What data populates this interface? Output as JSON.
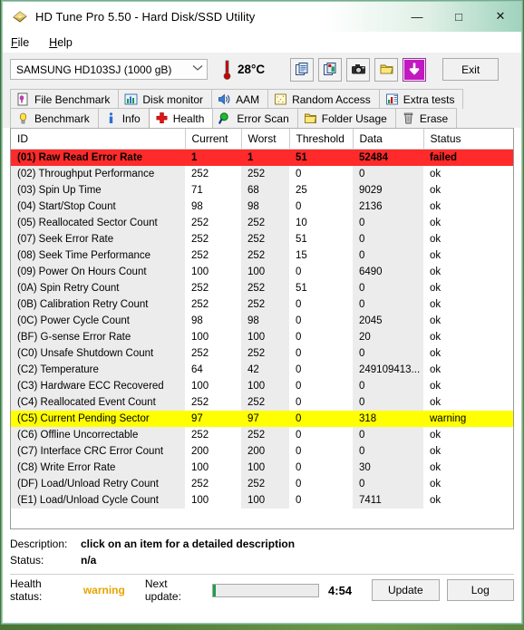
{
  "window": {
    "title": "HD Tune Pro 5.50 - Hard Disk/SSD Utility",
    "app_icon": "hard-disk-icon",
    "minimize": "—",
    "maximize": "□",
    "close": "✕"
  },
  "menu": {
    "items": [
      {
        "label": "File",
        "accel": "F"
      },
      {
        "label": "Help",
        "accel": "H"
      }
    ]
  },
  "toolbar": {
    "drive_selected": "SAMSUNG HD103SJ (1000 gB)",
    "dropdown_icon": "chevron-down-icon",
    "temperature": "28°C",
    "thermometer_icon": "thermometer-icon",
    "buttons": [
      {
        "name": "copy-icon"
      },
      {
        "name": "copy-image-icon"
      },
      {
        "name": "camera-icon"
      },
      {
        "name": "folder-gold-icon"
      },
      {
        "name": "download-arrow-icon"
      }
    ],
    "exit_label": "Exit"
  },
  "tabs": {
    "row1": [
      {
        "label": "File Benchmark",
        "icon": "file-benchmark-icon",
        "active": false
      },
      {
        "label": "Disk monitor",
        "icon": "disk-monitor-icon",
        "active": false
      },
      {
        "label": "AAM",
        "icon": "speaker-icon",
        "active": false
      },
      {
        "label": "Random Access",
        "icon": "random-access-icon",
        "active": false
      },
      {
        "label": "Extra tests",
        "icon": "extra-tests-icon",
        "active": false
      }
    ],
    "row2": [
      {
        "label": "Benchmark",
        "icon": "bulb-icon",
        "active": false
      },
      {
        "label": "Info",
        "icon": "info-icon",
        "active": false
      },
      {
        "label": "Health",
        "icon": "health-cross-icon",
        "active": true
      },
      {
        "label": "Error Scan",
        "icon": "magnifier-icon",
        "active": false
      },
      {
        "label": "Folder Usage",
        "icon": "folder-icon",
        "active": false
      },
      {
        "label": "Erase",
        "icon": "trash-icon",
        "active": false
      }
    ]
  },
  "table": {
    "columns": [
      "ID",
      "Current",
      "Worst",
      "Threshold",
      "Data",
      "Status"
    ],
    "rows": [
      {
        "id": "(01) Raw Read Error Rate",
        "current": "1",
        "worst": "1",
        "threshold": "51",
        "data": "52484",
        "status": "failed",
        "state": "failed"
      },
      {
        "id": "(02) Throughput Performance",
        "current": "252",
        "worst": "252",
        "threshold": "0",
        "data": "0",
        "status": "ok",
        "state": "normal"
      },
      {
        "id": "(03) Spin Up Time",
        "current": "71",
        "worst": "68",
        "threshold": "25",
        "data": "9029",
        "status": "ok",
        "state": "normal"
      },
      {
        "id": "(04) Start/Stop Count",
        "current": "98",
        "worst": "98",
        "threshold": "0",
        "data": "2136",
        "status": "ok",
        "state": "normal"
      },
      {
        "id": "(05) Reallocated Sector Count",
        "current": "252",
        "worst": "252",
        "threshold": "10",
        "data": "0",
        "status": "ok",
        "state": "normal"
      },
      {
        "id": "(07) Seek Error Rate",
        "current": "252",
        "worst": "252",
        "threshold": "51",
        "data": "0",
        "status": "ok",
        "state": "normal"
      },
      {
        "id": "(08) Seek Time Performance",
        "current": "252",
        "worst": "252",
        "threshold": "15",
        "data": "0",
        "status": "ok",
        "state": "normal"
      },
      {
        "id": "(09) Power On Hours Count",
        "current": "100",
        "worst": "100",
        "threshold": "0",
        "data": "6490",
        "status": "ok",
        "state": "normal"
      },
      {
        "id": "(0A) Spin Retry Count",
        "current": "252",
        "worst": "252",
        "threshold": "51",
        "data": "0",
        "status": "ok",
        "state": "normal"
      },
      {
        "id": "(0B) Calibration Retry Count",
        "current": "252",
        "worst": "252",
        "threshold": "0",
        "data": "0",
        "status": "ok",
        "state": "normal"
      },
      {
        "id": "(0C) Power Cycle Count",
        "current": "98",
        "worst": "98",
        "threshold": "0",
        "data": "2045",
        "status": "ok",
        "state": "normal"
      },
      {
        "id": "(BF) G-sense Error Rate",
        "current": "100",
        "worst": "100",
        "threshold": "0",
        "data": "20",
        "status": "ok",
        "state": "normal"
      },
      {
        "id": "(C0) Unsafe Shutdown Count",
        "current": "252",
        "worst": "252",
        "threshold": "0",
        "data": "0",
        "status": "ok",
        "state": "normal"
      },
      {
        "id": "(C2) Temperature",
        "current": "64",
        "worst": "42",
        "threshold": "0",
        "data": "249109413...",
        "status": "ok",
        "state": "normal"
      },
      {
        "id": "(C3) Hardware ECC Recovered",
        "current": "100",
        "worst": "100",
        "threshold": "0",
        "data": "0",
        "status": "ok",
        "state": "normal"
      },
      {
        "id": "(C4) Reallocated Event Count",
        "current": "252",
        "worst": "252",
        "threshold": "0",
        "data": "0",
        "status": "ok",
        "state": "normal"
      },
      {
        "id": "(C5) Current Pending Sector",
        "current": "97",
        "worst": "97",
        "threshold": "0",
        "data": "318",
        "status": "warning",
        "state": "warning"
      },
      {
        "id": "(C6) Offline Uncorrectable",
        "current": "252",
        "worst": "252",
        "threshold": "0",
        "data": "0",
        "status": "ok",
        "state": "normal"
      },
      {
        "id": "(C7) Interface CRC Error Count",
        "current": "200",
        "worst": "200",
        "threshold": "0",
        "data": "0",
        "status": "ok",
        "state": "normal"
      },
      {
        "id": "(C8) Write Error Rate",
        "current": "100",
        "worst": "100",
        "threshold": "0",
        "data": "30",
        "status": "ok",
        "state": "normal"
      },
      {
        "id": "(DF) Load/Unload Retry Count",
        "current": "252",
        "worst": "252",
        "threshold": "0",
        "data": "0",
        "status": "ok",
        "state": "normal"
      },
      {
        "id": "(E1) Load/Unload Cycle Count",
        "current": "100",
        "worst": "100",
        "threshold": "0",
        "data": "7411",
        "status": "ok",
        "state": "normal"
      }
    ]
  },
  "detail": {
    "description_label": "Description:",
    "description_value": "click on an item for a detailed description",
    "status_label": "Status:",
    "status_value": "n/a"
  },
  "footer": {
    "health_label": "Health status:",
    "health_value": "warning",
    "health_color": "#e8a400",
    "next_update_label": "Next update:",
    "next_update_time": "4:54",
    "progress_percent": 2,
    "update_label": "Update",
    "log_label": "Log"
  }
}
